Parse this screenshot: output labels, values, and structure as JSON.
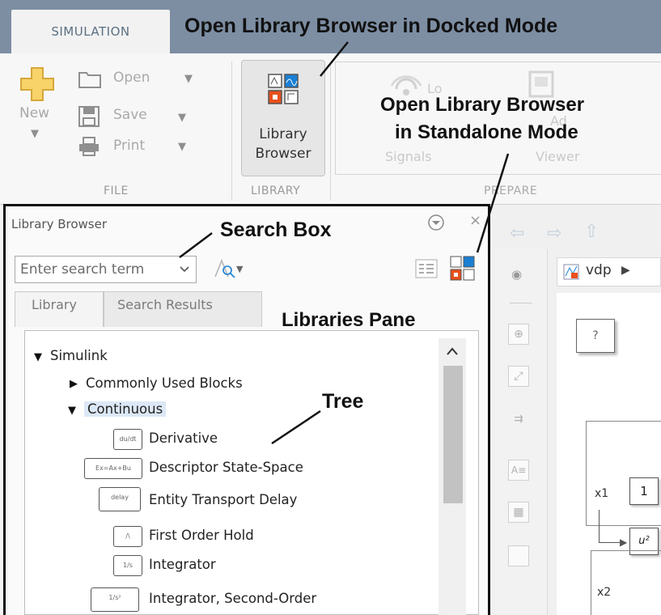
{
  "toolstrip": {
    "tab_simulation": "SIMULATION",
    "file": {
      "new_label": "New",
      "open_label": "Open",
      "save_label": "Save",
      "print_label": "Print",
      "group_label": "FILE"
    },
    "library": {
      "button_label_line1": "Library",
      "button_label_line2": "Browser",
      "group_label": "LIBRARY"
    },
    "prepare": {
      "signals_label": "Signals",
      "viewer_label": "Viewer",
      "group_label": "PREPARE",
      "log_label": "Lo",
      "add_label": "Ad"
    }
  },
  "library_browser": {
    "title": "Library Browser",
    "search_placeholder": "Enter search term",
    "tabs": [
      "Library",
      "Search Results"
    ],
    "tree": {
      "root": "Simulink",
      "items": [
        {
          "label": "Commonly Used Blocks",
          "level": 1,
          "state": "collapsed"
        },
        {
          "label": "Continuous",
          "level": 1,
          "state": "expanded",
          "selected": true
        },
        {
          "label": "Derivative",
          "level": 2,
          "icon": "derivative-block-icon"
        },
        {
          "label": "Descriptor State-Space",
          "level": 2,
          "icon": "descriptor-state-space-block-icon"
        },
        {
          "label": "Entity Transport Delay",
          "level": 2,
          "icon": "entity-transport-delay-block-icon"
        },
        {
          "label": "First Order Hold",
          "level": 2,
          "icon": "first-order-hold-block-icon"
        },
        {
          "label": "Integrator",
          "level": 2,
          "icon": "integrator-block-icon"
        },
        {
          "label": "Integrator, Second-Order",
          "level": 2,
          "icon": "integrator-second-order-block-icon"
        }
      ]
    }
  },
  "model_editor": {
    "breadcrumb": "vdp",
    "unknown_block": "?",
    "signal_x1": "x1",
    "signal_x2": "x2",
    "gain_value": "1",
    "square_label": "u²"
  },
  "annotations": {
    "docked_mode": "Open Library Browser in Docked Mode",
    "standalone_line1": "Open Library Browser",
    "standalone_line2": "in Standalone Mode",
    "search_box": "Search Box",
    "libraries_pane": "Libraries Pane",
    "tree": "Tree"
  },
  "colors": {
    "top_strip": "#7d8ea3",
    "selection_highlight": "#dce8f6",
    "library_icon_orange": "#e8501c",
    "library_icon_blue": "#1a7fd4"
  }
}
